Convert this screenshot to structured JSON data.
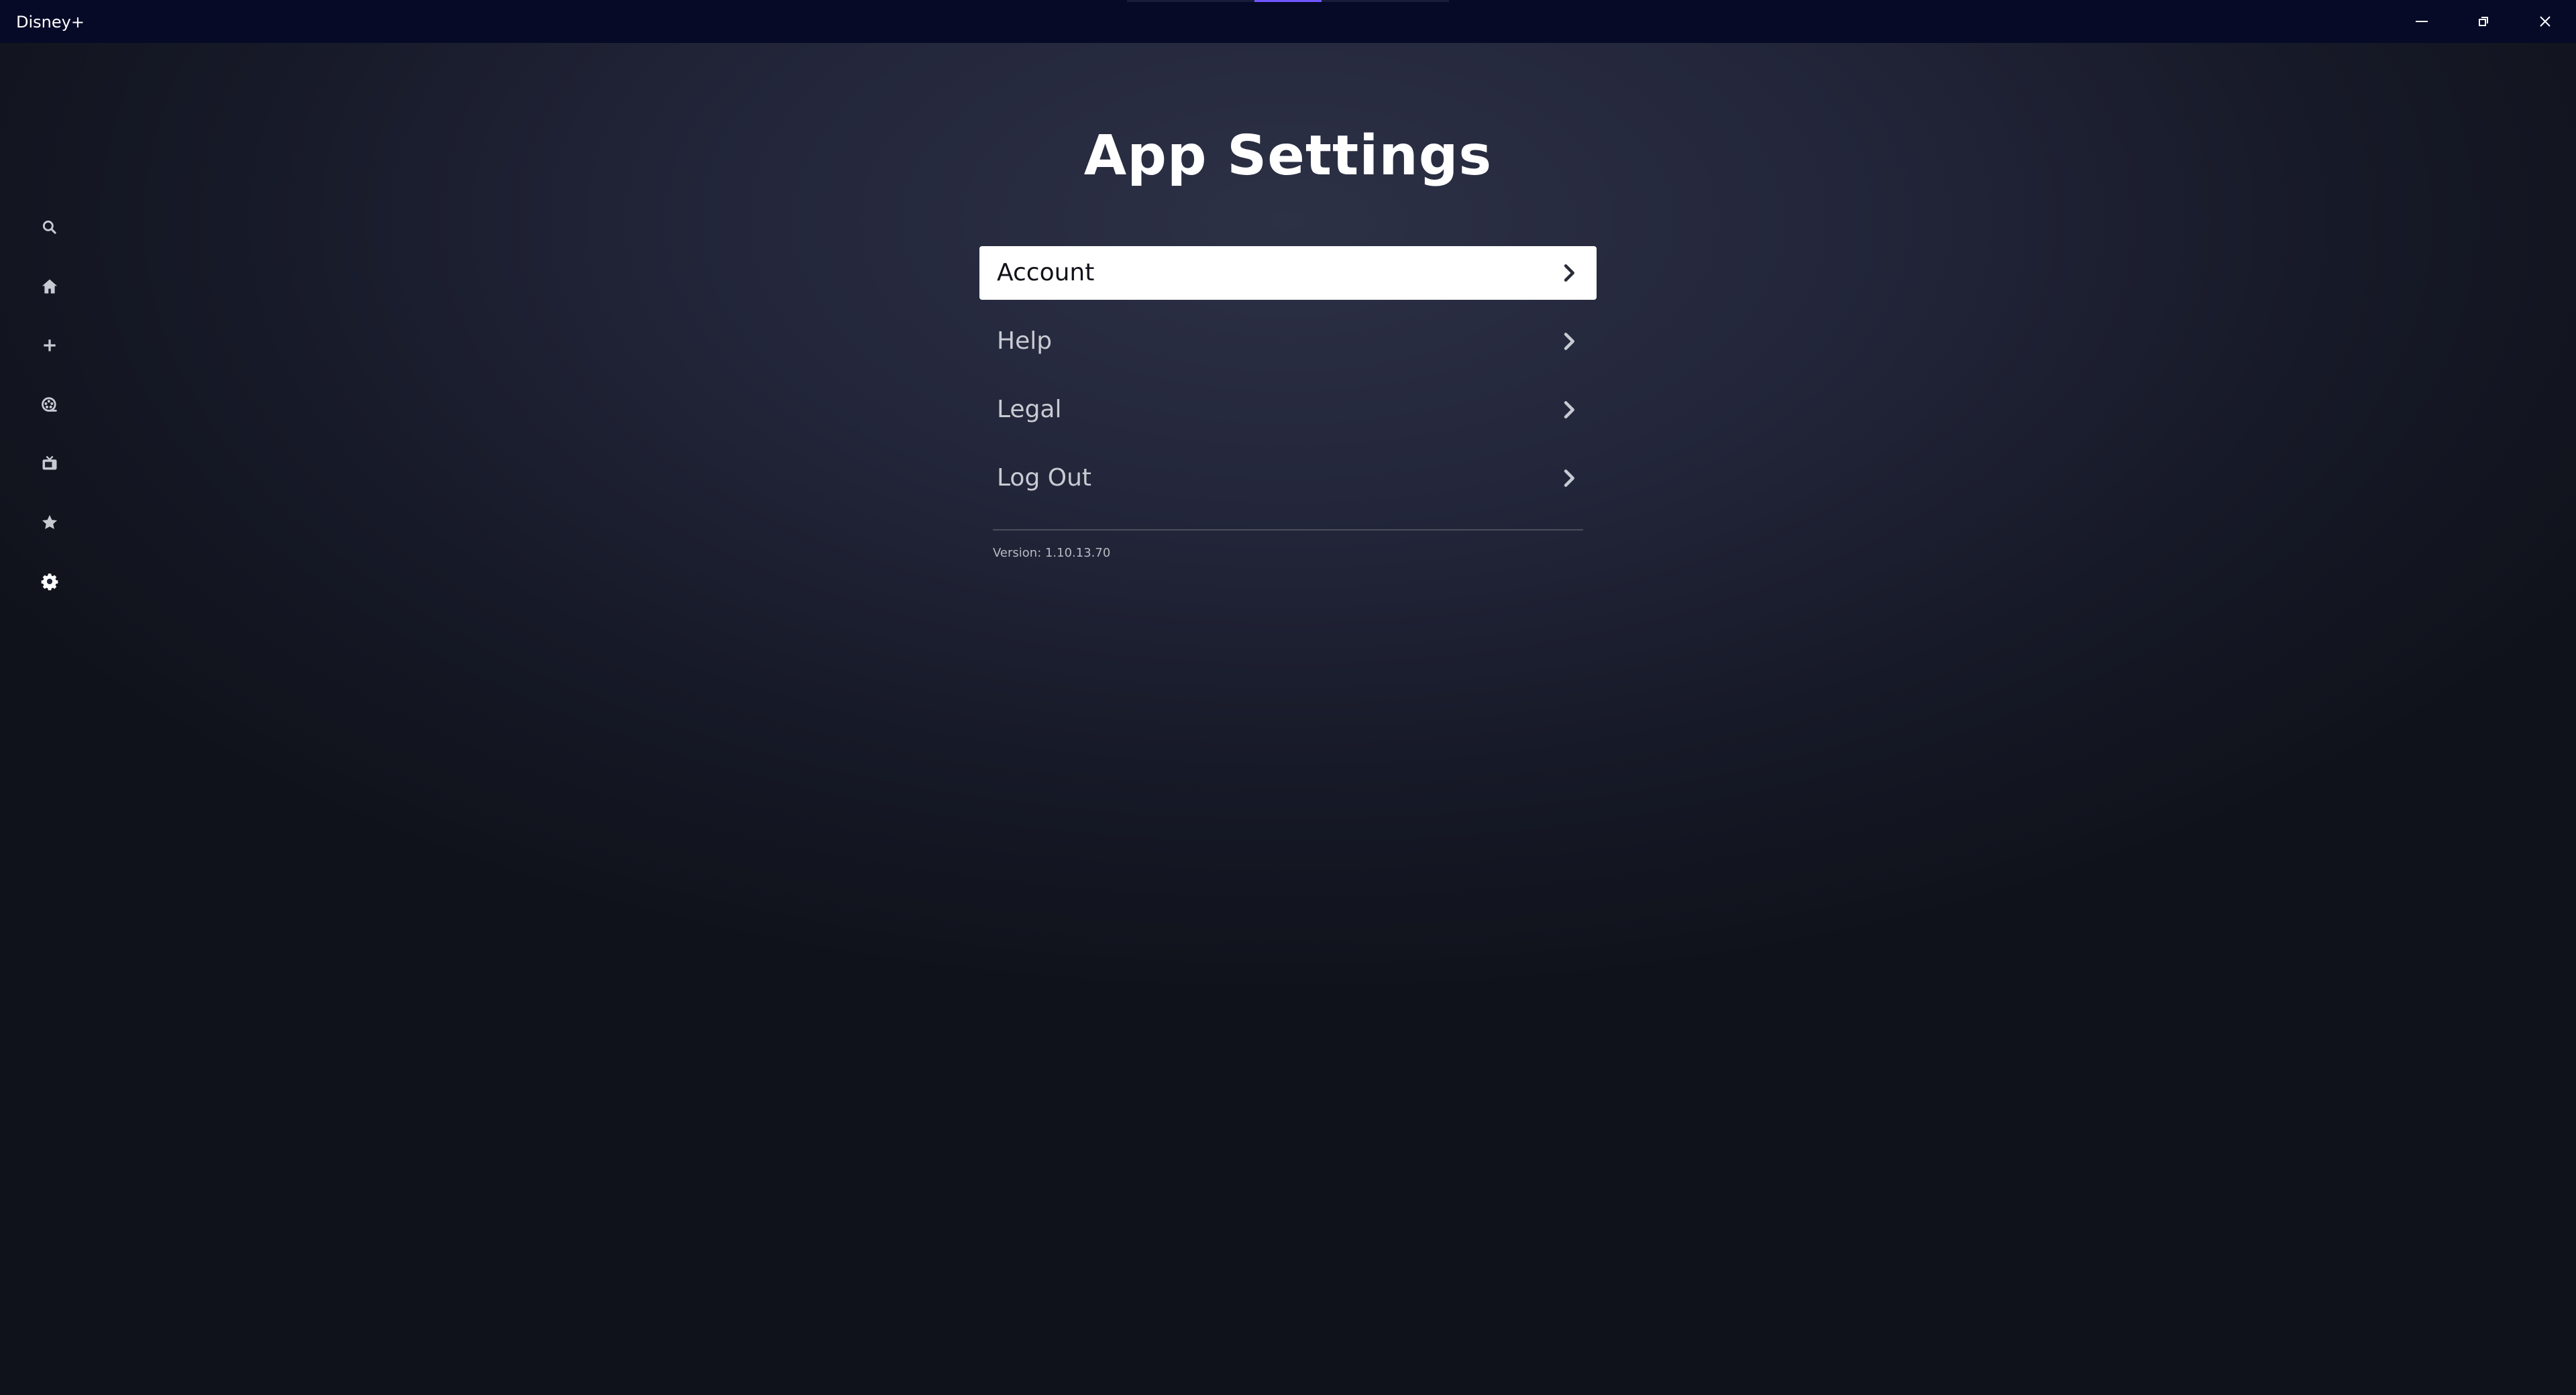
{
  "window": {
    "title": "Disney+",
    "controls": [
      "minimize-icon",
      "restore-icon",
      "close-icon"
    ]
  },
  "sidebar": {
    "items": [
      {
        "icon": "search-icon",
        "label": "Search"
      },
      {
        "icon": "home-icon",
        "label": "Home"
      },
      {
        "icon": "plus-icon",
        "label": "Add"
      },
      {
        "icon": "movie-icon",
        "label": "Movies"
      },
      {
        "icon": "tv-icon",
        "label": "Series"
      },
      {
        "icon": "star-icon",
        "label": "Originals"
      },
      {
        "icon": "gear-icon",
        "label": "Settings"
      }
    ]
  },
  "main": {
    "title": "App Settings",
    "menu": [
      {
        "label": "Account",
        "selected": true
      },
      {
        "label": "Help",
        "selected": false
      },
      {
        "label": "Legal",
        "selected": false
      },
      {
        "label": "Log Out",
        "selected": false
      }
    ],
    "version": "Version: 1.10.13.70"
  },
  "colors": {
    "titlebar": "#070a27",
    "background_center": "#2d3145",
    "background_edge": "#10121b",
    "selected_item": "#ffffff",
    "accent": "#6f56ff"
  }
}
